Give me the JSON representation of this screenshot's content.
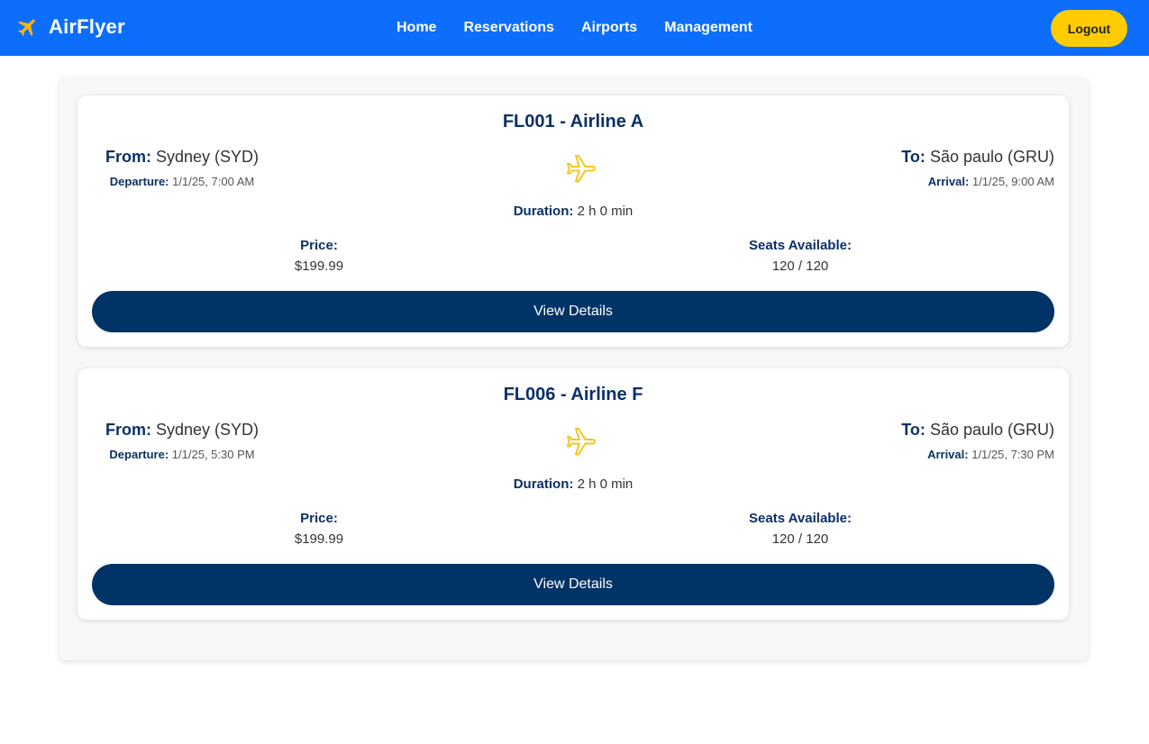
{
  "header": {
    "brand": "AirFlyer",
    "nav": [
      "Home",
      "Reservations",
      "Airports",
      "Management"
    ],
    "logout_label": "Logout",
    "colors": {
      "bar": "#0d6efd",
      "accent": "#ffcc00"
    }
  },
  "flights": [
    {
      "title": "FL001 - Airline A",
      "from_label": "From:",
      "from_value": "Sydney (SYD)",
      "to_label": "To:",
      "to_value": "São paulo (GRU)",
      "departure_label": "Departure:",
      "departure_value": "1/1/25, 7:00 AM",
      "arrival_label": "Arrival:",
      "arrival_value": "1/1/25, 9:00 AM",
      "duration_label": "Duration:",
      "duration_value": "2 h 0 min",
      "price_label": "Price:",
      "price_value": "$199.99",
      "seats_label": "Seats Available:",
      "seats_value": "120 / 120",
      "button_label": "View Details"
    },
    {
      "title": "FL006 - Airline F",
      "from_label": "From:",
      "from_value": "Sydney (SYD)",
      "to_label": "To:",
      "to_value": "São paulo (GRU)",
      "departure_label": "Departure:",
      "departure_value": "1/1/25, 5:30 PM",
      "arrival_label": "Arrival:",
      "arrival_value": "1/1/25, 7:30 PM",
      "duration_label": "Duration:",
      "duration_value": "2 h 0 min",
      "price_label": "Price:",
      "price_value": "$199.99",
      "seats_label": "Seats Available:",
      "seats_value": "120 / 120",
      "button_label": "View Details"
    }
  ],
  "icons": {
    "logo": "airplane-icon",
    "route": "airplane-outline-icon"
  }
}
